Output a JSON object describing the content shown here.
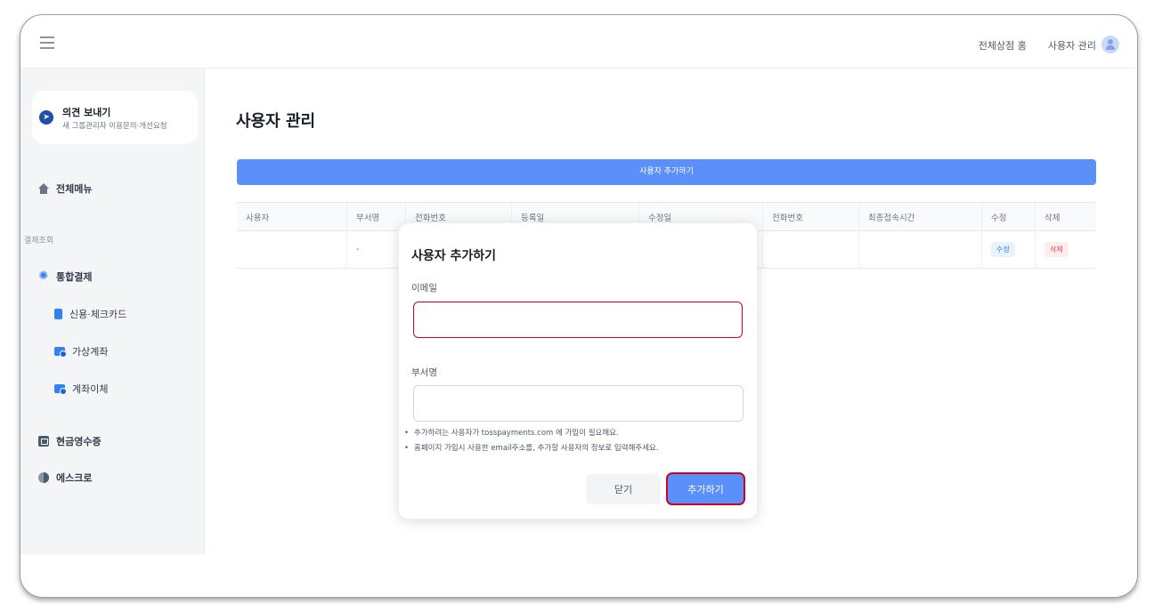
{
  "topbar": {
    "links": [
      "전체상점 홈",
      "사용자 관리"
    ]
  },
  "sidebar": {
    "feedback": {
      "title": "의견 보내기",
      "subtitle": "새 그룹관리자 이용문의·개선요청"
    },
    "all_menu": "전체메뉴",
    "section_label": "결제조회",
    "items": [
      {
        "label": "통합결제",
        "icon": "sun-icon"
      },
      {
        "label": "신용·체크카드",
        "icon": "card-icon"
      },
      {
        "label": "가상계좌",
        "icon": "virtual-account-icon"
      },
      {
        "label": "계좌이체",
        "icon": "bank-transfer-icon"
      },
      {
        "label": "현금영수증",
        "icon": "receipt-icon"
      },
      {
        "label": "에스크로",
        "icon": "escrow-icon"
      }
    ]
  },
  "main": {
    "title": "사용자 관리",
    "add_button": "사용자 추가하기",
    "table": {
      "headers": [
        "사용자",
        "부서명",
        "전화번호",
        "등록일",
        "수정일",
        "전화번호",
        "최종접속시간",
        "수정",
        "삭제"
      ],
      "rows": [
        {
          "user": "",
          "dept": "-",
          "edit": "수정",
          "delete": "삭제"
        }
      ]
    }
  },
  "modal": {
    "title": "사용자 추가하기",
    "email_label": "이메일",
    "email_value": "",
    "dept_label": "부서명",
    "dept_value": "",
    "notes": [
      "추가하려는 사용자가 tosspayments.com 에 가입이 필요해요.",
      "홈페이지 가입시 사용한 email주소를, 추가할 사용자의 정보로 입력해주세요."
    ],
    "close_button": "닫기",
    "add_button": "추가하기"
  },
  "colors": {
    "accent": "#5b8ff9",
    "highlight": "#d4001c",
    "danger": "#f04452"
  }
}
